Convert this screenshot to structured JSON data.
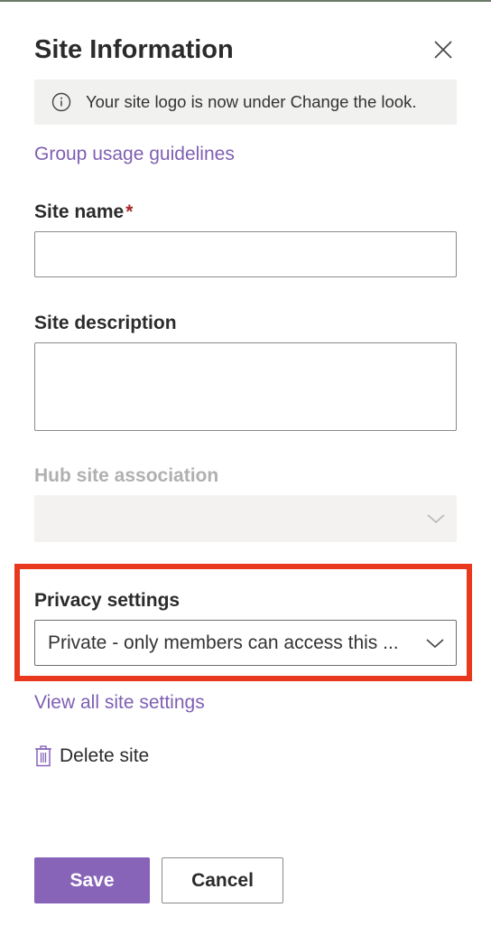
{
  "panel": {
    "title": "Site Information",
    "close_icon": "close-icon"
  },
  "info_bar": {
    "icon": "info-icon",
    "text": "Your site logo is now under Change the look."
  },
  "links": {
    "group_usage": "Group usage guidelines",
    "view_all_settings": "View all site settings"
  },
  "fields": {
    "site_name": {
      "label": "Site name",
      "required_mark": "*",
      "value": ""
    },
    "site_description": {
      "label": "Site description",
      "value": ""
    },
    "hub_site": {
      "label": "Hub site association",
      "value": "",
      "disabled": true
    },
    "privacy": {
      "label": "Privacy settings",
      "value": "Private - only members can access this ..."
    }
  },
  "delete": {
    "icon": "trash-icon",
    "label": "Delete site"
  },
  "buttons": {
    "save": "Save",
    "cancel": "Cancel"
  },
  "colors": {
    "accent": "#8764b8",
    "link": "#7f5fb3",
    "highlight_frame": "#e8391f",
    "required": "#a4262c"
  }
}
